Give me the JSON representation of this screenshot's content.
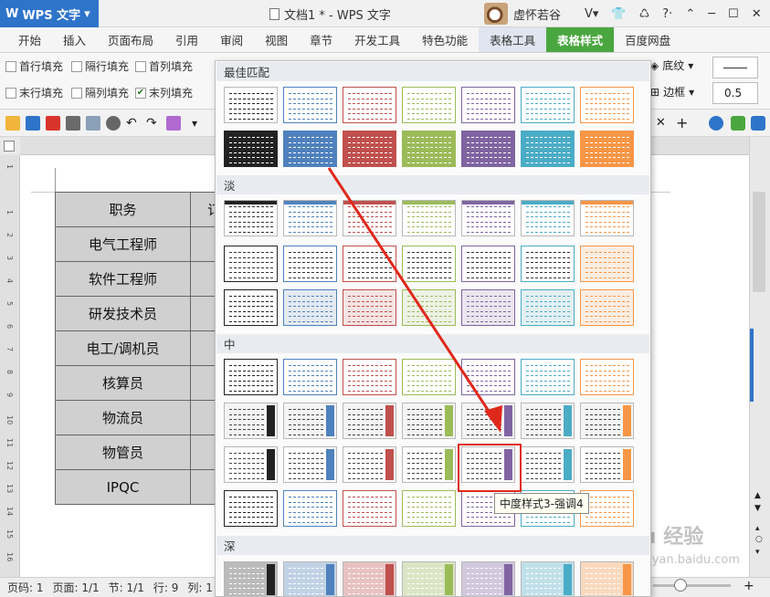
{
  "titlebar": {
    "app": "WPS 文字",
    "doc_title": "文档1 * - WPS 文字",
    "user": "虚怀若谷"
  },
  "tabs": [
    "开始",
    "插入",
    "页面布局",
    "引用",
    "审阅",
    "视图",
    "章节",
    "开发工具",
    "特色功能",
    "表格工具",
    "表格样式",
    "百度网盘"
  ],
  "active_tab": "表格样式",
  "ribbon": {
    "row1": [
      "首行填充",
      "隔行填充",
      "首列填充"
    ],
    "row2": [
      "末行填充",
      "隔列填充",
      "末列填充"
    ],
    "row2_checked": [
      false,
      false,
      true
    ],
    "shading": "底纹",
    "border": "边框",
    "line_width": "0.5"
  },
  "document": {
    "rows": [
      "职务",
      "电气工程师",
      "软件工程师",
      "研发技术员",
      "电工/调机员",
      "核算员",
      "物流员",
      "物管员",
      "IPQC"
    ],
    "col2_first": "订"
  },
  "gallery": {
    "sections": [
      "最佳匹配",
      "淡",
      "中",
      "深"
    ],
    "tooltip": "中度样式3-强调4"
  },
  "status": {
    "page": "页码: 1",
    "pages": "页面: 1/1",
    "section": "节: 1/1",
    "row": "行: 9",
    "col": "列: 1"
  },
  "colors": {
    "accent1": "#4f81bd",
    "accent2": "#c0504d",
    "accent3": "#9bbb59",
    "accent4": "#8064a2",
    "accent5": "#4bacc6",
    "accent6": "#f79646",
    "annotation": "#e0281c",
    "active_tab": "#4aa63f"
  },
  "watermark": "Baidu 经验 jingyan.baidu.com"
}
